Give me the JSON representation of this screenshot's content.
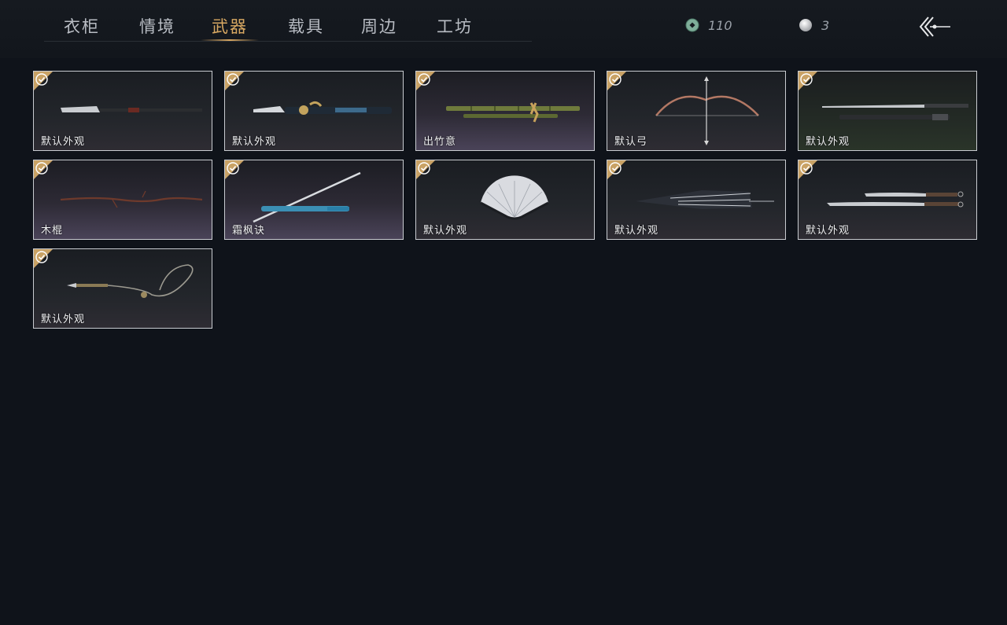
{
  "tabs": [
    {
      "label": "衣柜",
      "active": false
    },
    {
      "label": "情境",
      "active": false
    },
    {
      "label": "武器",
      "active": true
    },
    {
      "label": "载具",
      "active": false
    },
    {
      "label": "周边",
      "active": false
    },
    {
      "label": "工坊",
      "active": false
    }
  ],
  "currency": {
    "jade_amount": "110",
    "pearl_amount": "3"
  },
  "items": [
    {
      "label": "默认外观",
      "icon": "blade-icon",
      "equipped": true
    },
    {
      "label": "默认外观",
      "icon": "halberd-icon",
      "equipped": true
    },
    {
      "label": "出竹意",
      "icon": "bamboo-icon",
      "equipped": true
    },
    {
      "label": "默认弓",
      "icon": "bow-icon",
      "equipped": true
    },
    {
      "label": "默认外观",
      "icon": "twin-swords-icon",
      "equipped": true
    },
    {
      "label": "木棍",
      "icon": "staff-icon",
      "equipped": true
    },
    {
      "label": "霜枫诀",
      "icon": "katana-icon",
      "equipped": true
    },
    {
      "label": "默认外观",
      "icon": "fan-icon",
      "equipped": true
    },
    {
      "label": "默认外观",
      "icon": "umbrella-icon",
      "equipped": true
    },
    {
      "label": "默认外观",
      "icon": "dual-blades-icon",
      "equipped": true
    },
    {
      "label": "默认外观",
      "icon": "rope-dart-icon",
      "equipped": true
    }
  ],
  "colors": {
    "accent_gold": "#d8a862",
    "background": "#0f131a",
    "card_border": "#c9ccd1"
  }
}
